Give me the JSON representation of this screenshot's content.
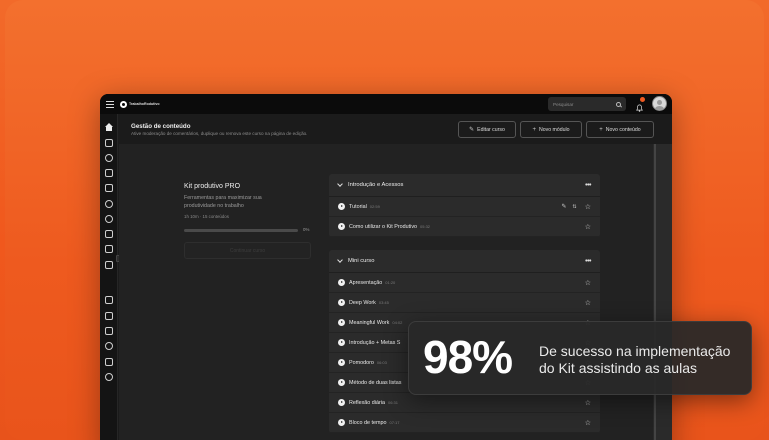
{
  "topbar": {
    "logo_text_line1": "TrabalhoRodutivo",
    "search_placeholder": "Pesquisar",
    "notification_count": ""
  },
  "sidebar": {
    "tab_label": "⇥"
  },
  "header": {
    "title": "Gestão de conteúdo",
    "subtitle": "Ative moderação de comentários, duplique ou remova este curso na página de edição.",
    "edit_course": "Editar curso",
    "new_module": "Novo módulo",
    "new_content": "Novo conteúdo"
  },
  "course": {
    "title": "Kit produtivo PRO",
    "description": "Ferramentas para maximizar sua produtividade no trabalho",
    "meta": "1h 10m · 15 conteúdos",
    "progress_percent": 0,
    "progress_label": "0%",
    "continue_label": "Continuar curso"
  },
  "modules": [
    {
      "name": "Introdução e Acessos",
      "lessons": [
        {
          "title": "Tutorial",
          "duration": "02:59"
        },
        {
          "title": "Como utilizar o Kit Produtivo",
          "duration": "05:32"
        }
      ]
    },
    {
      "name": "Mini curso",
      "lessons": [
        {
          "title": "Apresentação",
          "duration": "01:20"
        },
        {
          "title": "Deep Work",
          "duration": "03:45"
        },
        {
          "title": "Meaningful Work",
          "duration": "04:02"
        },
        {
          "title": "Introdução + Metas S",
          "duration": ""
        },
        {
          "title": "Pomodoro",
          "duration": "06:03"
        },
        {
          "title": "Método de duas listas",
          "duration": ""
        },
        {
          "title": "Reflexão diária",
          "duration": "06:31"
        },
        {
          "title": "Bloco de tempo",
          "duration": "07:17"
        }
      ]
    }
  ],
  "stat": {
    "number": "98%",
    "text": "De sucesso na implementação do Kit assistindo as aulas"
  },
  "colors": {
    "accent": "#ef5a22",
    "background_gradient_top": "#f3702e",
    "app_dark": "#1b1b1b"
  }
}
